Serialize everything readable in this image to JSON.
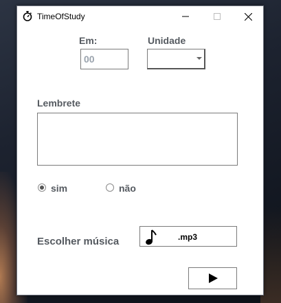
{
  "app": {
    "title": "TimeOfStudy",
    "icon": "stopwatch-icon"
  },
  "window_controls": {
    "minimize_icon": "minimize-icon",
    "maximize_icon": "maximize-icon",
    "close_icon": "close-icon"
  },
  "form": {
    "em_label": "Em:",
    "em_value": "00",
    "unidade_label": "Unidade",
    "unidade_value": "",
    "lembrete_label": "Lembrete",
    "lembrete_value": "",
    "radio_sim_label": "sim",
    "radio_nao_label": "não",
    "selected_option": "sim",
    "musica_label": "Escolher música",
    "music_extension": ".mp3",
    "music_icon": "music-note-icon",
    "play_icon": "play-icon"
  },
  "colors": {
    "label": "#555a60",
    "placeholder": "#9aa3ad",
    "border": "#7a7a7a"
  }
}
